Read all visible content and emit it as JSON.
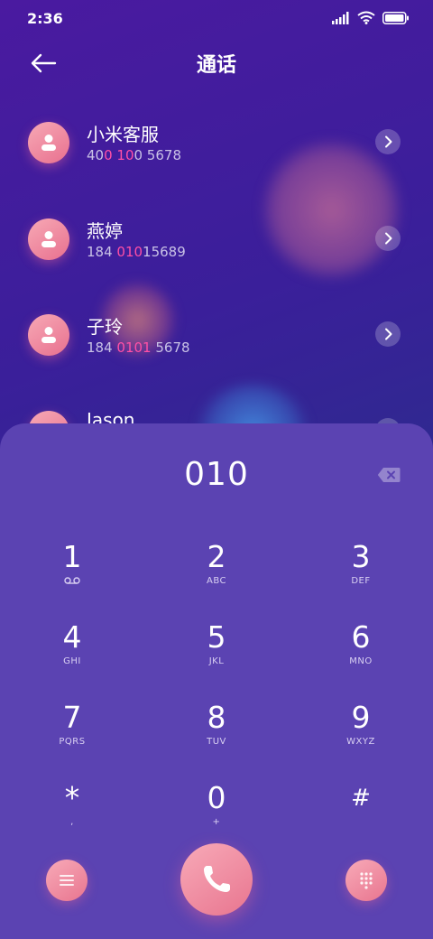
{
  "status": {
    "time": "2:36"
  },
  "header": {
    "title": "通话"
  },
  "contacts": [
    {
      "name": "小米客服",
      "number_parts": [
        "40",
        "0 10",
        "0 5678"
      ]
    },
    {
      "name": "燕婷",
      "number_parts": [
        "184 ",
        "010",
        "15689"
      ]
    },
    {
      "name": "子玲",
      "number_parts": [
        "184 ",
        "0101",
        " 5678"
      ]
    },
    {
      "name": "Jason"
    }
  ],
  "dialer": {
    "entered": "010",
    "keys": [
      {
        "digit": "1",
        "sub": ""
      },
      {
        "digit": "2",
        "sub": "ABC"
      },
      {
        "digit": "3",
        "sub": "DEF"
      },
      {
        "digit": "4",
        "sub": "GHI"
      },
      {
        "digit": "5",
        "sub": "JKL"
      },
      {
        "digit": "6",
        "sub": "MNO"
      },
      {
        "digit": "7",
        "sub": "PQRS"
      },
      {
        "digit": "8",
        "sub": "TUV"
      },
      {
        "digit": "9",
        "sub": "WXYZ"
      },
      {
        "digit": "*",
        "sub": ","
      },
      {
        "digit": "0",
        "sub": "+"
      },
      {
        "digit": "#",
        "sub": ""
      }
    ]
  },
  "colors": {
    "highlight": "#ff4fa6",
    "accent_pink": "#e8708f",
    "dialpad_bg": "#5b43b2"
  },
  "icons": {
    "back": "arrow-left-icon",
    "chevron": "chevron-right-icon",
    "backspace": "backspace-icon",
    "voicemail": "voicemail-icon",
    "menu": "menu-icon",
    "call": "phone-icon",
    "keypad": "keypad-icon"
  }
}
